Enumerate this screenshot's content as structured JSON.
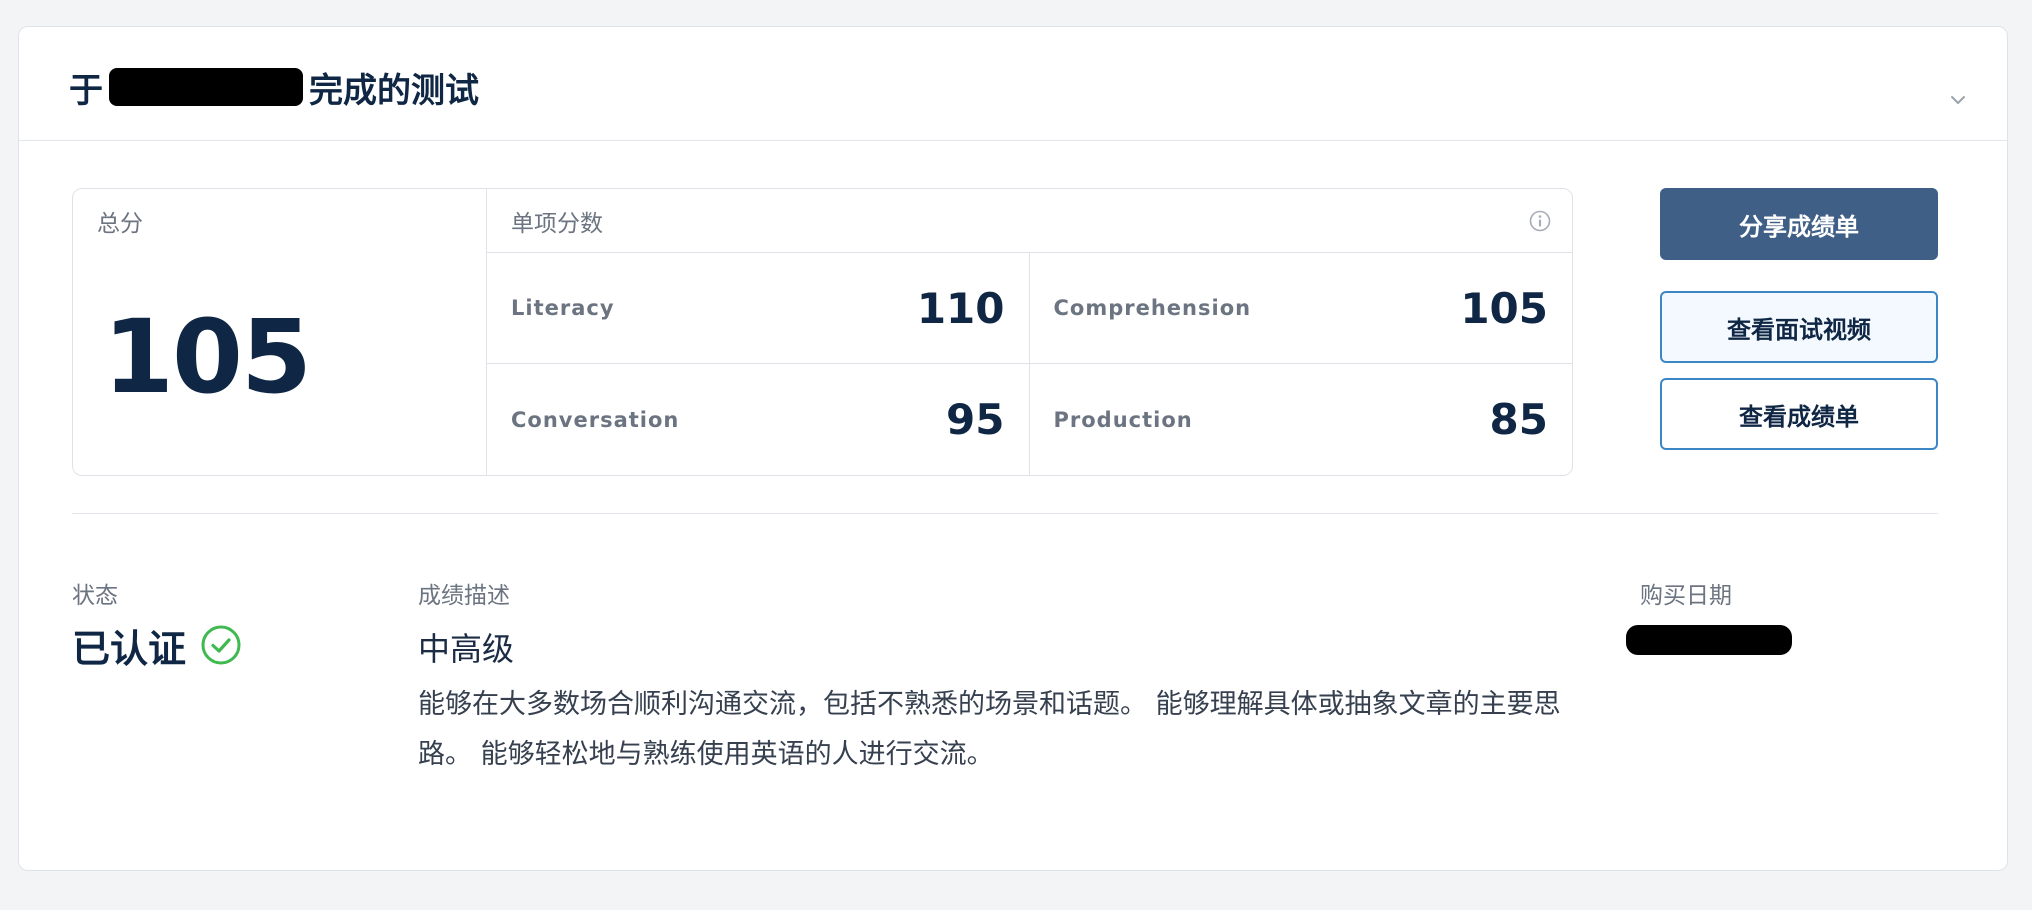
{
  "header": {
    "title_prefix": "于",
    "title_suffix": "完成的测试"
  },
  "scores": {
    "total_label": "总分",
    "total_value": "105",
    "subscores_label": "单项分数",
    "items": [
      {
        "label": "Literacy",
        "value": "110"
      },
      {
        "label": "Comprehension",
        "value": "105"
      },
      {
        "label": "Conversation",
        "value": "95"
      },
      {
        "label": "Production",
        "value": "85"
      }
    ]
  },
  "actions": {
    "share": "分享成绩单",
    "watch_video": "查看面试视频",
    "view_certificate": "查看成绩单"
  },
  "details": {
    "status_label": "状态",
    "status_value": "已认证",
    "description_label": "成绩描述",
    "level": "中高级",
    "description": "能够在大多数场合顺利沟通交流，包括不熟悉的场景和话题。 能够理解具体或抽象文章的主要思路。 能够轻松地与熟练使用英语的人进行交流。",
    "purchase_date_label": "购买日期"
  },
  "colors": {
    "primary_button": "#3f5f87",
    "outline_border": "#3d86c6",
    "verified_green": "#3fb950",
    "text_dark": "#0f2744"
  },
  "icons": {
    "collapse": "chevron-down-icon",
    "info": "info-icon",
    "verified": "check-circle-icon"
  }
}
